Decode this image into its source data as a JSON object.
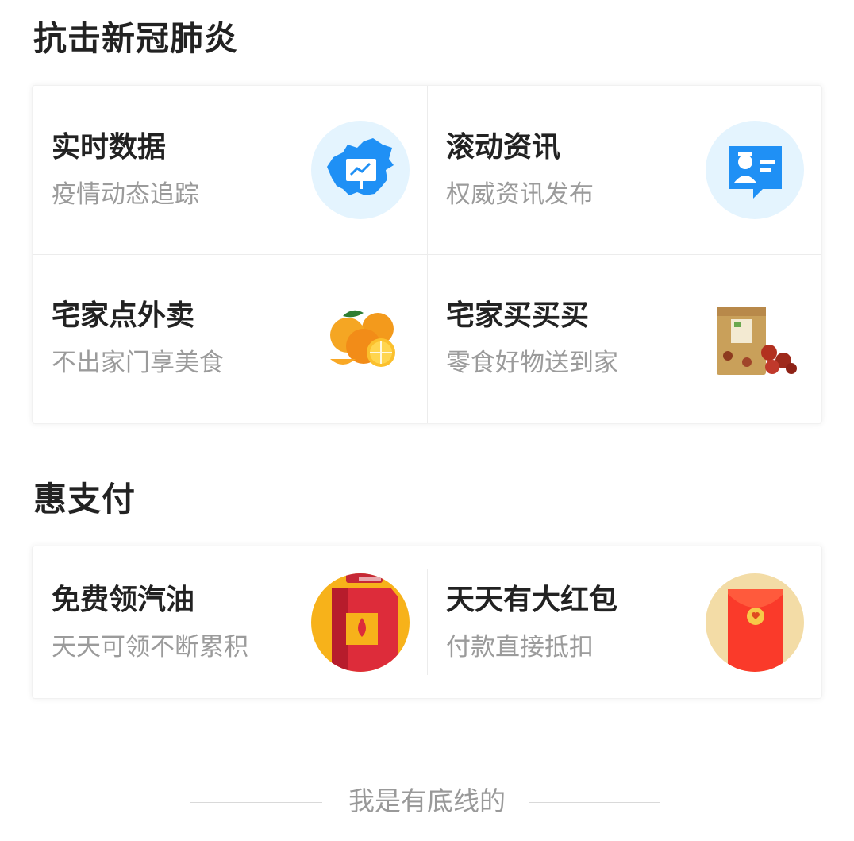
{
  "sections": [
    {
      "title": "抗击新冠肺炎",
      "items": [
        {
          "title": "实时数据",
          "subtitle": "疫情动态追踪",
          "icon": "china-map-chart-icon"
        },
        {
          "title": "滚动资讯",
          "subtitle": "权威资讯发布",
          "icon": "doctor-id-card-icon"
        },
        {
          "title": "宅家点外卖",
          "subtitle": "不出家门享美食",
          "icon": "oranges-image"
        },
        {
          "title": "宅家买买买",
          "subtitle": "零食好物送到家",
          "icon": "snack-bag-image"
        }
      ]
    },
    {
      "title": "惠支付",
      "items": [
        {
          "title": "免费领汽油",
          "subtitle": "天天可领不断累积",
          "icon": "fuel-can-icon"
        },
        {
          "title": "天天有大红包",
          "subtitle": "付款直接抵扣",
          "icon": "red-envelope-icon"
        }
      ]
    }
  ],
  "footer": {
    "text": "我是有底线的"
  },
  "colors": {
    "title": "#222222",
    "subtitle": "#9b9b9b",
    "icon_bg_blue": "#e4f4fe",
    "icon_blue": "#1f90f5",
    "fuel_bg": "#f7b21a",
    "fuel_red": "#dd2c3a",
    "envelope_bg": "#f3dca6",
    "envelope_red": "#fa3a2a"
  }
}
